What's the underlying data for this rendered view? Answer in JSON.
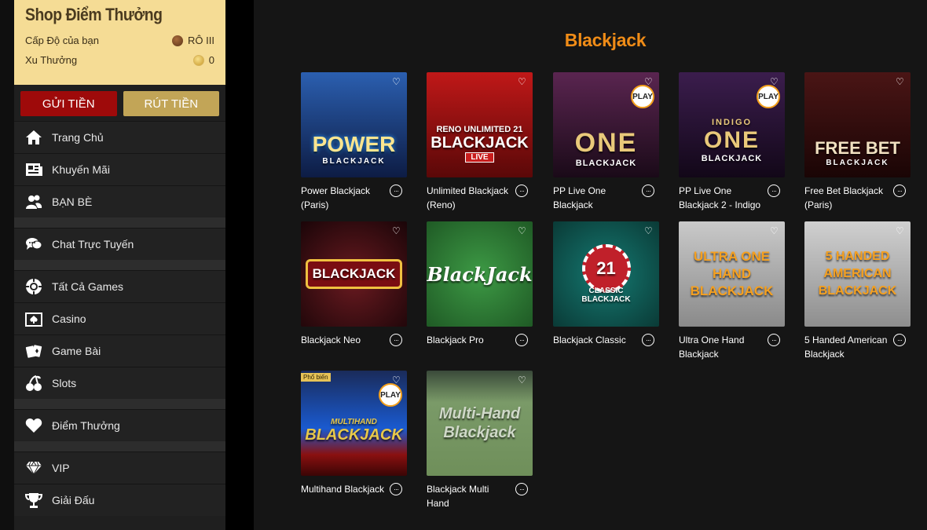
{
  "sidebar": {
    "shop_title": "Shop Điểm Thưởng",
    "level_label": "Cấp Độ của bạn",
    "level_value": "RÔ III",
    "points_label": "Xu Thưởng",
    "points_value": "0",
    "deposit_label": "GỬI TIỀN",
    "withdraw_label": "RÚT TIỀN",
    "nav": [
      {
        "label": "Trang Chủ",
        "icon": "home-icon"
      },
      {
        "label": "Khuyến Mãi",
        "icon": "newspaper-icon"
      },
      {
        "label": "BẠN BÈ",
        "icon": "friends-icon"
      },
      {
        "label": "Chat Trực Tuyến",
        "icon": "chat-icon"
      },
      {
        "label": "Tất Cả Games",
        "icon": "chip-icon"
      },
      {
        "label": "Casino",
        "icon": "casino-icon"
      },
      {
        "label": "Game Bài",
        "icon": "cards-icon"
      },
      {
        "label": "Slots",
        "icon": "cherries-icon"
      },
      {
        "label": "Điểm Thưởng",
        "icon": "heart-icon"
      },
      {
        "label": "VIP",
        "icon": "diamond-icon"
      },
      {
        "label": "Giải Đấu",
        "icon": "trophy-icon"
      }
    ]
  },
  "main": {
    "section_title": "Blackjack",
    "games": [
      {
        "name": "Power Blackjack (Paris)",
        "art": "POWER",
        "art_sub": "BLACKJACK",
        "bg": "#1d3b7a",
        "play": false
      },
      {
        "name": "Unlimited Blackjack (Reno)",
        "art": "BLACKJACK",
        "art_sub": "LIVE",
        "art_top": "RENO UNLIMITED 21",
        "bg": "#8a1414",
        "play": false
      },
      {
        "name": "PP Live One Blackjack",
        "art": "ONE",
        "art_sub": "BLACKJACK",
        "bg": "#3a1a3a",
        "play": true
      },
      {
        "name": "PP Live One Blackjack 2 - Indigo",
        "art": "ONE",
        "art_sub": "BLACKJACK",
        "art_top": "INDIGO",
        "bg": "#2a1535",
        "play": true
      },
      {
        "name": "Free Bet Blackjack (Paris)",
        "art": "FREE BET",
        "art_sub": "BLACKJACK",
        "bg": "#3a1010",
        "play": false
      },
      {
        "name": "Blackjack Neo",
        "art": "BLACKJACK",
        "bg": "#3a0d12",
        "play": false
      },
      {
        "name": "Blackjack Pro",
        "art": "BlackJack",
        "bg": "#2f7a36",
        "play": false
      },
      {
        "name": "Blackjack Classic",
        "art": "21",
        "art_sub": "CLASSIC BLACKJACK",
        "bg": "#0f5a55",
        "play": false
      },
      {
        "name": "Ultra One Hand Blackjack",
        "art": "ULTRA ONE HAND BLACKJACK",
        "bg": "#a9a9a9",
        "play": false
      },
      {
        "name": "5 Handed American Blackjack",
        "art": "5 HANDED AMERICAN BLACKJACK",
        "bg": "#b0b0b0",
        "play": false
      },
      {
        "name": "Multihand Blackjack",
        "art": "BLACKJACK",
        "art_top": "MULTIHAND",
        "bg": "#123a8a",
        "play": true,
        "badge": "Phổ biến"
      },
      {
        "name": "Blackjack Multi Hand",
        "art": "Multi-Hand Blackjack",
        "bg": "#6f8f5a",
        "play": false
      }
    ],
    "play_label": "PLAY",
    "more_label": "···"
  },
  "colors": {
    "accent": "#f08c17",
    "deposit": "#9e0a0a",
    "withdraw": "#c2a557",
    "shop_bg": "#f5dc95"
  }
}
